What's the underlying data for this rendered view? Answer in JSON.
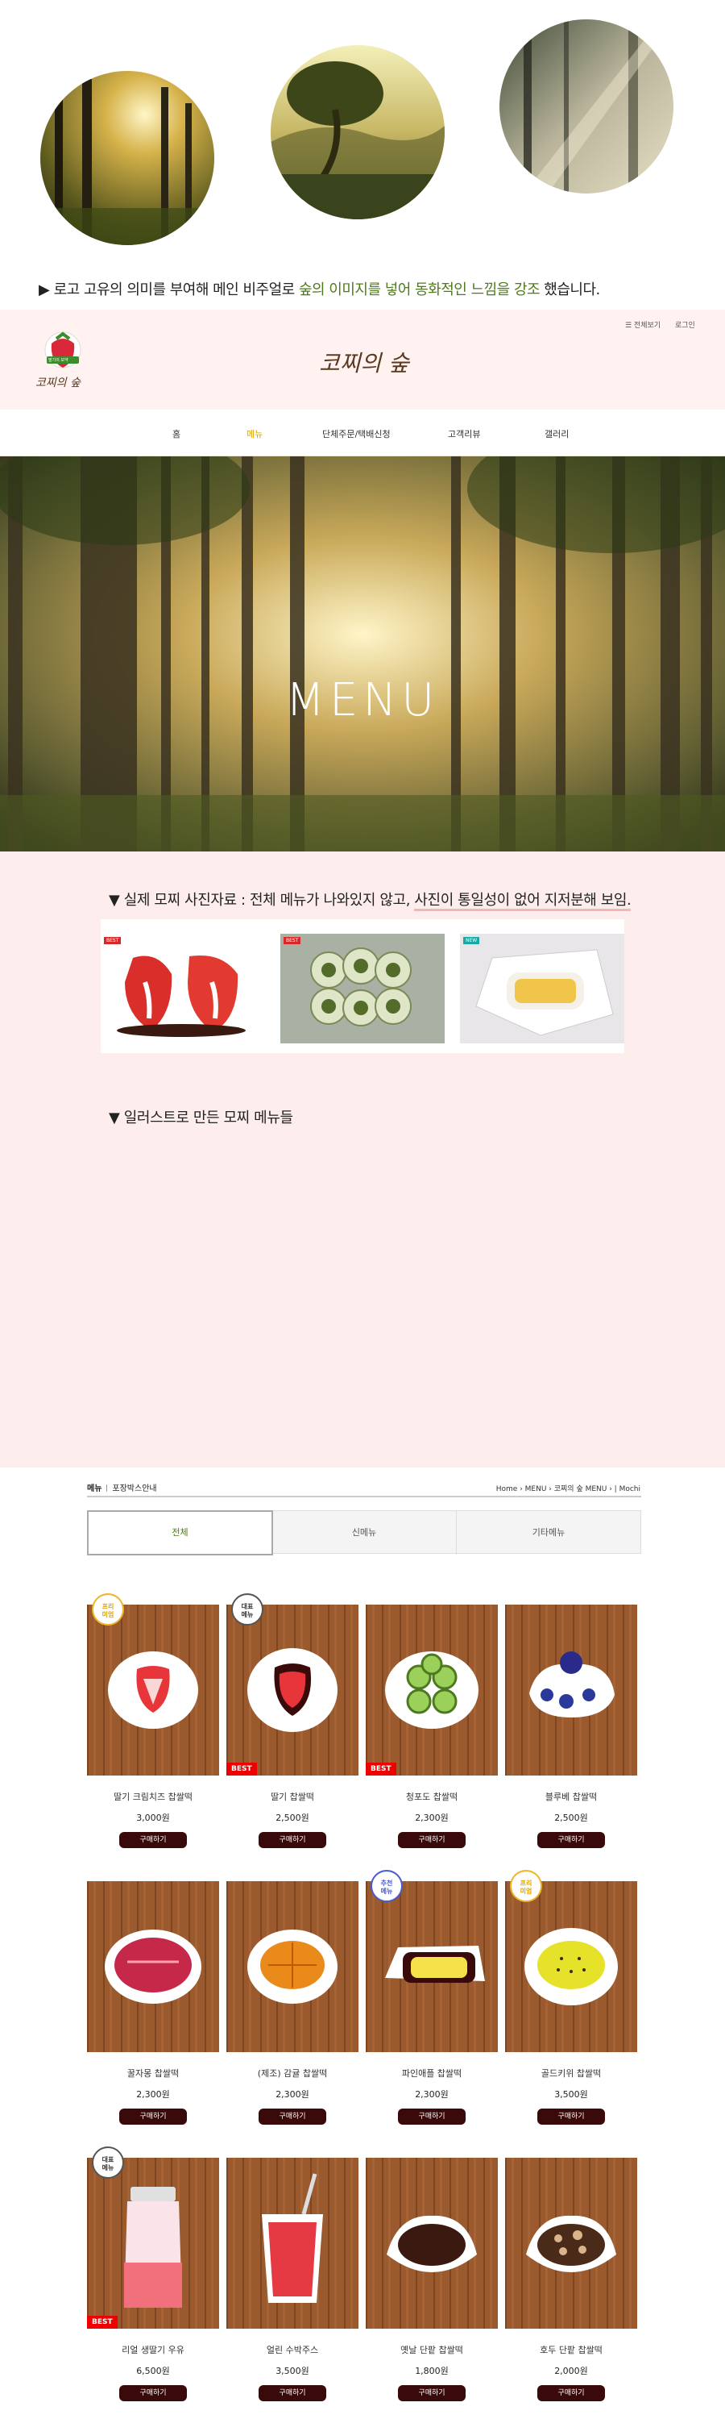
{
  "intro": {
    "arrow": "▶",
    "text_a": "로고 고유의 의미를 부여해 메인 비주얼로 ",
    "text_b": "숲의 이미지를 넣어 동화적인 느낌을 강조",
    "text_c": " 했습니다."
  },
  "header": {
    "logo_badge": "딸기의 보약",
    "logo_text": "코찌의 숲",
    "brand": "코찌의 숲",
    "util_all": "☰ 전체보기",
    "util_login": "로그인"
  },
  "nav": {
    "items": [
      {
        "label": "홈",
        "active": false
      },
      {
        "label": "메뉴",
        "active": true
      },
      {
        "label": "단체주문/택배신청",
        "active": false
      },
      {
        "label": "고객리뷰",
        "active": false
      },
      {
        "label": "갤러리",
        "active": false
      }
    ]
  },
  "hero": {
    "title": "MENU"
  },
  "section1": {
    "title_a": "▼ 실제 모찌 사진자료 : 전체 메뉴가 나와있지 않고, ",
    "title_b": "사진이 통일성이 없어 지저분해 보임."
  },
  "photos": [
    {
      "tag": "BEST"
    },
    {
      "tag": "BEST"
    },
    {
      "tag": "NEW"
    }
  ],
  "section2": {
    "title": "▼ 일러스트로 만든 모찌 메뉴들"
  },
  "shop": {
    "title": "메뉴",
    "subtitle": "포장박스안내",
    "breadcrumb": "Home  ›  MENU  ›  코찌의 숲 MENU  ›  | Mochi",
    "tabs": [
      "전체",
      "신메뉴",
      "기타메뉴"
    ],
    "buy_label": "구매하기",
    "products": [
      {
        "name": "딸기 크림치즈 찹쌀떡",
        "price": "3,000원",
        "badge": "프리\n미엄",
        "best": false
      },
      {
        "name": "딸기 찹쌀떡",
        "price": "2,500원",
        "badge": "대표\n메뉴",
        "best": true
      },
      {
        "name": "청포도 찹쌀떡",
        "price": "2,300원",
        "badge": "",
        "best": true
      },
      {
        "name": "블루베 찹쌀떡",
        "price": "2,500원",
        "badge": "",
        "best": false
      },
      {
        "name": "꿀자몽 찹쌀떡",
        "price": "2,300원",
        "badge": "",
        "best": false
      },
      {
        "name": "(제조) 감귤 찹쌀떡",
        "price": "2,300원",
        "badge": "",
        "best": false
      },
      {
        "name": "파인애플 찹쌀떡",
        "price": "2,300원",
        "badge": "추천\n메뉴",
        "best": false
      },
      {
        "name": "골드키위 찹쌀떡",
        "price": "3,500원",
        "badge": "프리\n미엄",
        "best": false
      },
      {
        "name": "리얼 생딸기 우유",
        "price": "6,500원",
        "badge": "대표\n메뉴",
        "best": true
      },
      {
        "name": "얼린 수박주스",
        "price": "3,500원",
        "badge": "",
        "best": false
      },
      {
        "name": "옛날 단팥 찹쌀떡",
        "price": "1,800원",
        "badge": "",
        "best": false
      },
      {
        "name": "호두 단팥 찹쌀떡",
        "price": "2,000원",
        "badge": "",
        "best": false
      }
    ]
  },
  "colors": {
    "accent_green": "#4e7a1c",
    "nav_active": "#e0a000",
    "pink_bg": "#fdeeed",
    "buy_btn": "#3a0a0a",
    "best_red": "#e00000"
  }
}
